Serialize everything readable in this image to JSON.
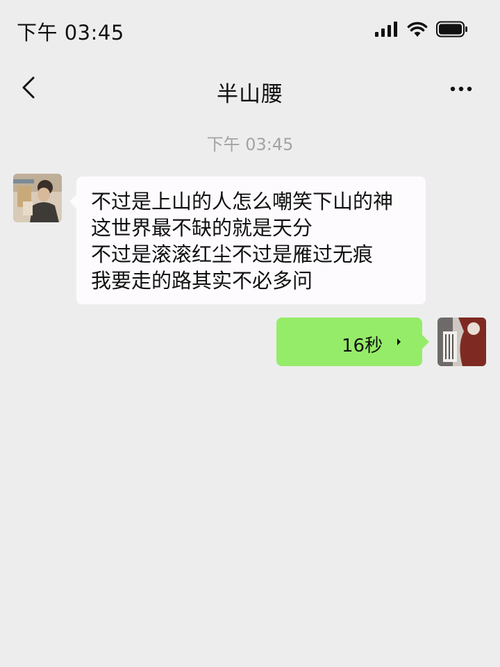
{
  "status_bar": {
    "time": "下午 03:45",
    "icons": [
      "signal-icon",
      "wifi-icon",
      "battery-icon"
    ]
  },
  "nav": {
    "back_icon": "chevron-left-icon",
    "title": "半山腰",
    "more_icon": "more-dots-icon"
  },
  "chat": {
    "timestamp": "下午 03:45",
    "incoming": {
      "lines": [
        "不过是上山的人怎么嘲笑下山的神",
        "这世界最不缺的就是天分",
        "不过是滚滚红尘不过是雁过无痕",
        "我要走的路其实不必多问"
      ]
    },
    "outgoing_voice": {
      "duration": "16秒",
      "icon": "voice-wave-icon"
    }
  },
  "colors": {
    "background": "#ededed",
    "incoming_bubble": "#fdfbfe",
    "outgoing_bubble": "#95ec69",
    "timestamp": "#a3a3a3"
  }
}
